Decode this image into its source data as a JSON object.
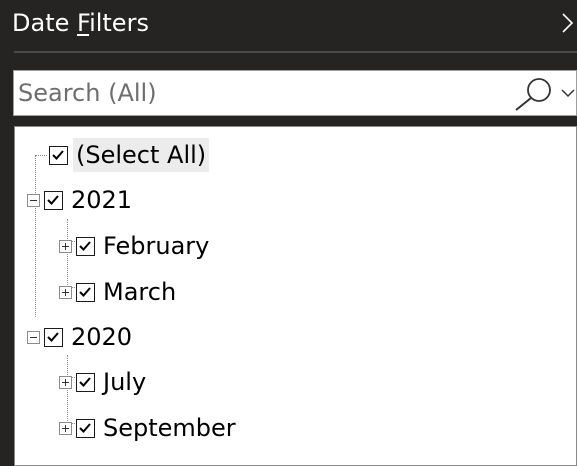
{
  "menu": {
    "label_prefix": "Date ",
    "label_accel": "F",
    "label_suffix": "ilters"
  },
  "search": {
    "placeholder": "Search (All)",
    "value": ""
  },
  "icons": {
    "search": "magnifier-icon",
    "dropdown": "chevron-down-icon",
    "submenu": "chevron-right-icon"
  },
  "tree": {
    "select_all": {
      "label": "(Select All)",
      "checked": true
    },
    "years": [
      {
        "label": "2021",
        "checked": true,
        "expanded": true,
        "months": [
          {
            "label": "February",
            "checked": true,
            "expanded": false
          },
          {
            "label": "March",
            "checked": true,
            "expanded": false
          }
        ]
      },
      {
        "label": "2020",
        "checked": true,
        "expanded": true,
        "months": [
          {
            "label": "July",
            "checked": true,
            "expanded": false
          },
          {
            "label": "September",
            "checked": true,
            "expanded": false
          }
        ]
      }
    ]
  },
  "colors": {
    "panel_bg": "#252423",
    "list_bg": "#ffffff",
    "text_light": "#ffffff",
    "text_dark": "#000000",
    "selection": "#ececec"
  }
}
